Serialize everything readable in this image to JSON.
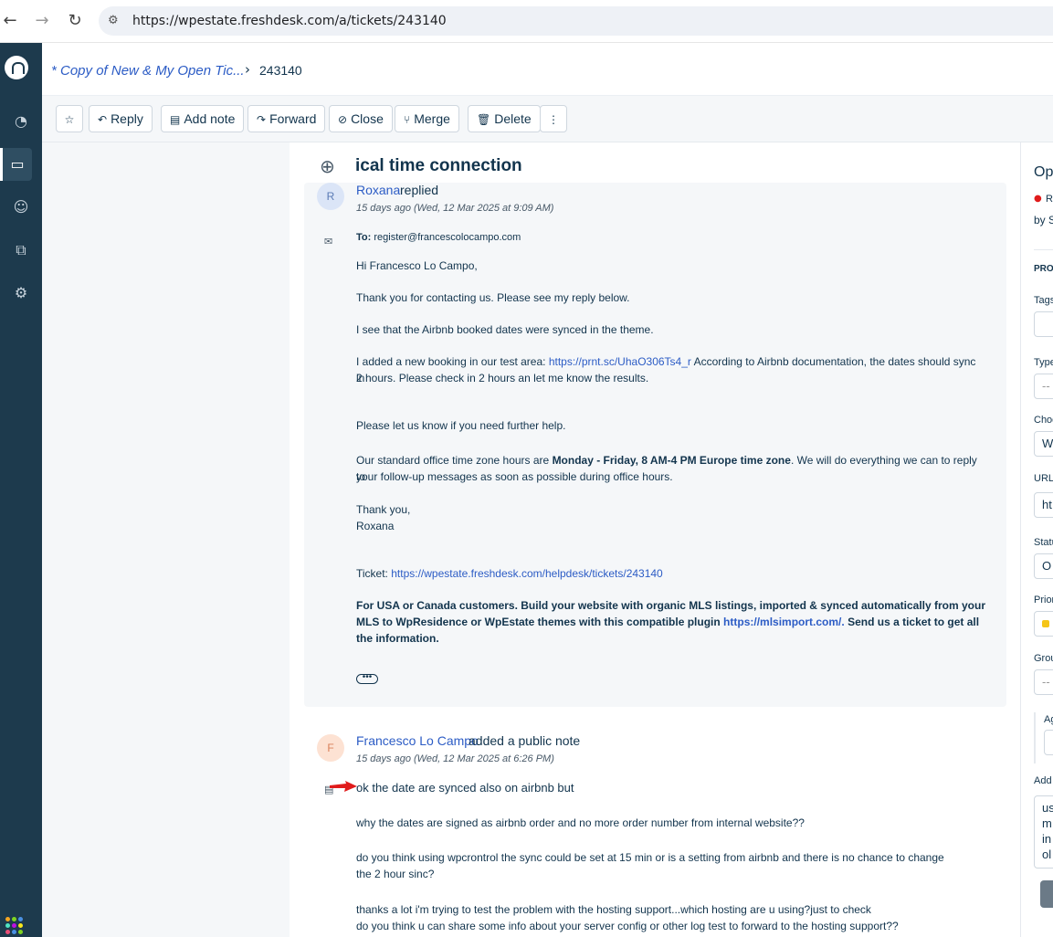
{
  "browser": {
    "back_icon": "←",
    "forward_icon": "→",
    "reload_icon": "↻",
    "site_icon": "⚙",
    "url": "https://wpestate.freshdesk.com/a/tickets/243140"
  },
  "rail": {
    "items": [
      "dashboard-icon",
      "tickets-icon",
      "contacts-icon",
      "solutions-icon",
      "admin-icon"
    ],
    "glyphs": [
      "◔",
      "▭",
      "☺",
      "⧉",
      "⚙"
    ]
  },
  "header": {
    "breadcrumb": "* Copy of New & My Open Tic...",
    "separator": "›",
    "ticket_id": "243140"
  },
  "toolbar": {
    "star_icon": "☆",
    "reply_icon": "↶",
    "reply": "Reply",
    "note_icon": "▤",
    "add_note": "Add note",
    "forward_icon": "↷",
    "forward": "Forward",
    "close_icon": "⊘",
    "close": "Close",
    "merge_icon": "⑂",
    "merge": "Merge",
    "delete_icon": "🗑",
    "delete": "Delete",
    "more_icon": "⋮"
  },
  "ticket": {
    "subject_icon": "⊕",
    "subject": "ical time connection",
    "reply": {
      "avatar": "R",
      "author": "Roxana",
      "action": "replied",
      "time": "15 days ago (Wed, 12 Mar 2025 at 9:09 AM)",
      "to_label": "To:",
      "to_value": "register@francescolocampo.com",
      "greeting": "Hi Francesco Lo Campo,",
      "p1": "Thank you for contacting us. Please see my reply below.",
      "p2": "I see that the Airbnb booked dates were synced in the theme.",
      "p3_a": "I added a new booking in our test area: ",
      "p3_link": "https://prnt.sc/UhaO306Ts4_r",
      "p3_b": "  According to Airbnb documentation, the dates should sync in",
      "p3_c": "2 hours.  Please check in 2 hours an let me know the results.",
      "p4": "Please let us know if you need further help.",
      "p5_a": "Our standard office time zone hours are ",
      "p5_bold": "Monday - Friday, 8 AM-4 PM Europe time zone",
      "p5_b": ". We will do everything we can to reply to",
      "p5_c": "your follow-up messages as soon as possible during office hours.",
      "thanks": "Thank you,",
      "signature": "Roxana",
      "ticket_label": "Ticket: ",
      "ticket_link": "https://wpestate.freshdesk.com/helpdesk/tickets/243140",
      "promo_a": "For USA or Canada customers. Build your website with organic MLS listings, imported & synced automatically from your",
      "promo_b": "MLS to WpResidence or WpEstate themes with this compatible plugin ",
      "promo_link": "https://mlsimport.com/.",
      "promo_c": " Send us a ticket to get all",
      "promo_d": "the information.",
      "more": "•••"
    },
    "note": {
      "avatar": "F",
      "author": "Francesco Lo Campo",
      "action": "added a public note",
      "time": "15 days ago (Wed, 12 Mar 2025 at 6:26 PM)",
      "l1": "ok the date are synced also on airbnb but",
      "l2": "why the dates are signed as airbnb order and no more order number from internal website??",
      "l3": "do you think using wpcrontrol the sync could be set at 15 min or is a setting from airbnb and there is no chance to change",
      "l4": "the 2 hour sinc?",
      "l5": "thanks a lot i'm trying to test the problem with the hosting support...which hosting are u using?just to check",
      "l6": "do you think u can share some info about your server config or other log test to forward to the hosting support??"
    }
  },
  "right_panel": {
    "status_title": "Op",
    "status_dot": "●",
    "status_text": "R",
    "by_text": "by S",
    "section": "PRO",
    "tags": "Tags",
    "type": "Type",
    "type_value": "--",
    "choose": "Choo",
    "choose_value": "W",
    "url": "URL",
    "url_value": "ht",
    "status": "Statu",
    "status_value": "O",
    "priority": "Prior",
    "group": "Grou",
    "group_value": "--",
    "agent": "Ag",
    "add": "Add",
    "add_l1": "us",
    "add_l2": "m",
    "add_l3": "in",
    "add_l4": "ol"
  },
  "colors": {
    "rail": "#1d3a4d",
    "link": "#2c5cc5",
    "reply_avatar_bg": "#dbe5f7",
    "note_avatar_bg": "#fde2d3",
    "arrow": "#e01b1b"
  }
}
